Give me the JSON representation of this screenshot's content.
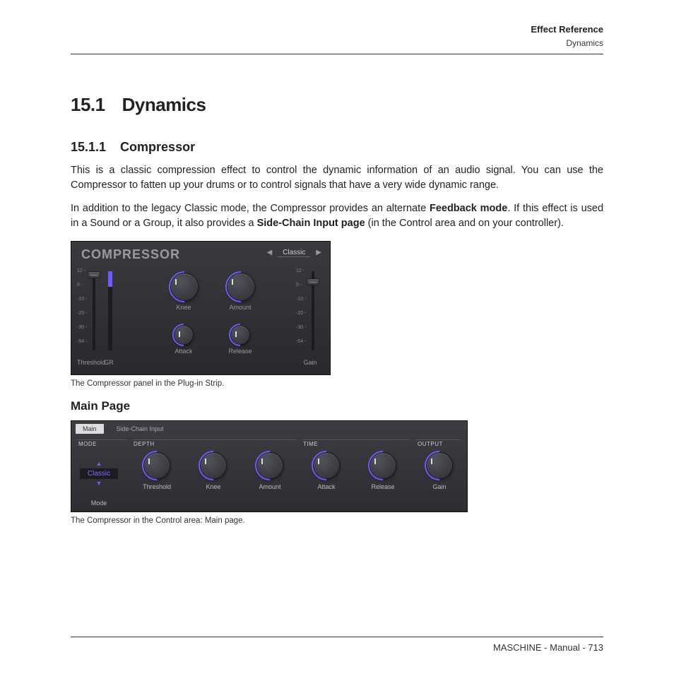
{
  "header": {
    "title": "Effect Reference",
    "subtitle": "Dynamics"
  },
  "section": {
    "number": "15.1",
    "title": "Dynamics"
  },
  "subsection": {
    "number": "15.1.1",
    "title": "Compressor"
  },
  "para1": "This is a classic compression effect to control the dynamic information of an audio signal. You can use the Compressor to fatten up your drums or to control signals that have a very wide dynamic range.",
  "para2_a": "In addition to the legacy Classic mode, the Compressor provides an alternate ",
  "para2_bold1": "Feedback mode",
  "para2_b": ". If this effect is used in a Sound or a Group, it also provides a ",
  "para2_bold2": "Side-Chain Input page",
  "para2_c": " (in the Control area and on your controller).",
  "plugin_panel": {
    "title": "COMPRESSOR",
    "preset": "Classic",
    "ticks": [
      "12 -",
      "0 -",
      "-10 -",
      "-20 -",
      "-30 -",
      "-54 -"
    ],
    "labels": {
      "threshold": "Threshold",
      "gr": "GR",
      "knee": "Knee",
      "amount": "Amount",
      "attack": "Attack",
      "release": "Release",
      "gain": "Gain"
    }
  },
  "caption1": "The Compressor panel in the Plug-in Strip.",
  "main_page_heading": "Main Page",
  "control_panel": {
    "tabs": {
      "main": "Main",
      "sidechain": "Side-Chain Input"
    },
    "sections": {
      "mode": "MODE",
      "depth": "DEPTH",
      "time": "TIME",
      "output": "OUTPUT"
    },
    "mode_value": "Classic",
    "labels": {
      "mode": "Mode",
      "threshold": "Threshold",
      "knee": "Knee",
      "amount": "Amount",
      "attack": "Attack",
      "release": "Release",
      "gain": "Gain"
    }
  },
  "caption2": "The Compressor in the Control area: Main page.",
  "footer": "MASCHINE - Manual - 713"
}
